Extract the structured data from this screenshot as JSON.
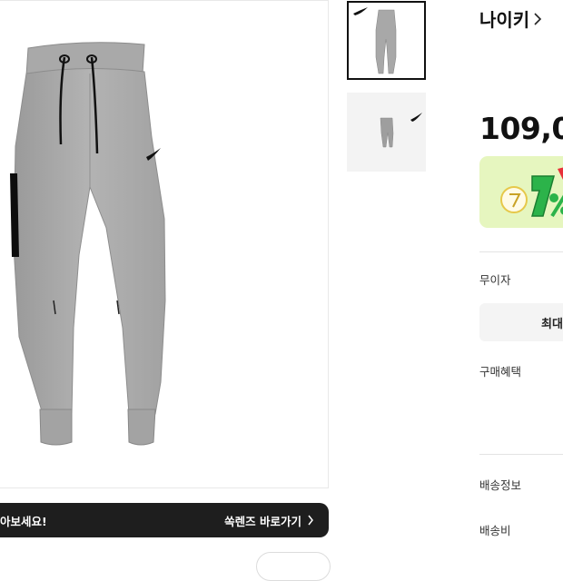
{
  "product": {
    "brand": "나이키",
    "price": "109,0",
    "main_image_alt": "product-main-image",
    "thumbnails": [
      "thumbnail-1",
      "thumbnail-2"
    ]
  },
  "info": {
    "interest_free_label": "무이자",
    "max_button_label": "최대",
    "benefits_label": "구매혜택",
    "shipping_info_label": "배송정보",
    "shipping_fee_label": "배송비"
  },
  "lens_bar": {
    "left_text": "아보세요!",
    "link_text": "쏙렌즈 바로가기"
  },
  "colors": {
    "dark_bar": "#1e1e1e",
    "promo_bg": "#e6f6bf",
    "promo_green": "#2cb34a",
    "promo_red": "#e8313a"
  }
}
